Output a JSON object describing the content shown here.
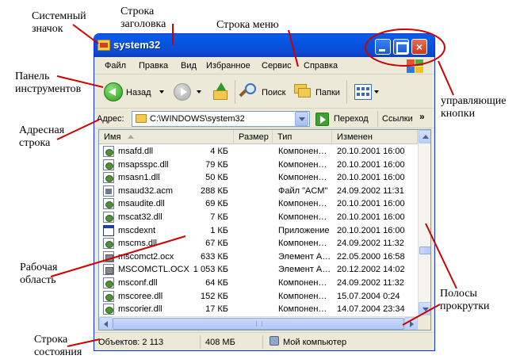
{
  "annotations": {
    "system_icon": "Системный\nзначок",
    "title_bar": "Строка\nзаголовка",
    "menu_bar": "Строка меню",
    "toolbar": "Панель\nинструментов",
    "address_bar": "Адресная\nстрока",
    "control_buttons": "управляющие\nкнопки",
    "work_area": "Рабочая\nобласть",
    "scrollbars": "Полосы\nпрокрутки",
    "status_bar": "Строка\nсостояния"
  },
  "window": {
    "title": "system32",
    "icon": "folder-icon"
  },
  "menu": [
    "Файл",
    "Правка",
    "Вид",
    "Избранное",
    "Сервис",
    "Справка"
  ],
  "toolbar": {
    "back_label": "Назад",
    "search_label": "Поиск",
    "folders_label": "Папки"
  },
  "address": {
    "label": "Адрес:",
    "value": "C:\\WINDOWS\\system32",
    "go_label": "Переход",
    "links_label": "Ссылки",
    "chevron": "»"
  },
  "columns": {
    "name": "Имя",
    "size": "Размер",
    "type": "Тип",
    "modified": "Изменен"
  },
  "files": [
    {
      "name": "msafd.dll",
      "size": "4 КБ",
      "type": "Компонен…",
      "modified": "20.10.2001 16:00",
      "icon": "dll"
    },
    {
      "name": "msapsspc.dll",
      "size": "79 КБ",
      "type": "Компонен…",
      "modified": "20.10.2001 16:00",
      "icon": "dll"
    },
    {
      "name": "msasn1.dll",
      "size": "50 КБ",
      "type": "Компонен…",
      "modified": "20.10.2001 16:00",
      "icon": "dll"
    },
    {
      "name": "msaud32.acm",
      "size": "288 КБ",
      "type": "Файл \"ACM\"",
      "modified": "24.09.2002 11:31",
      "icon": "acm"
    },
    {
      "name": "msaudite.dll",
      "size": "69 КБ",
      "type": "Компонен…",
      "modified": "20.10.2001 16:00",
      "icon": "dll"
    },
    {
      "name": "mscat32.dll",
      "size": "7 КБ",
      "type": "Компонен…",
      "modified": "20.10.2001 16:00",
      "icon": "dll"
    },
    {
      "name": "mscdexnt",
      "size": "1 КБ",
      "type": "Приложение",
      "modified": "20.10.2001 16:00",
      "icon": "exe"
    },
    {
      "name": "mscms.dll",
      "size": "67 КБ",
      "type": "Компонен…",
      "modified": "24.09.2002 11:32",
      "icon": "dll"
    },
    {
      "name": "mscomct2.ocx",
      "size": "633 КБ",
      "type": "Элемент А…",
      "modified": "22.05.2000 16:58",
      "icon": "ocx"
    },
    {
      "name": "MSCOMCTL.OCX",
      "size": "1 053 КБ",
      "type": "Элемент А…",
      "modified": "20.12.2002 14:02",
      "icon": "ocx"
    },
    {
      "name": "msconf.dll",
      "size": "64 КБ",
      "type": "Компонен…",
      "modified": "24.09.2002 11:32",
      "icon": "dll"
    },
    {
      "name": "mscoree.dll",
      "size": "152 КБ",
      "type": "Компонен…",
      "modified": "15.07.2004 0:24",
      "icon": "dll"
    },
    {
      "name": "mscorier.dll",
      "size": "17 КБ",
      "type": "Компонен…",
      "modified": "14.07.2004 23:34",
      "icon": "dll"
    }
  ],
  "status": {
    "objects": "Объектов: 2 113",
    "size": "408 МБ",
    "location": "Мой компьютер"
  },
  "colors": {
    "title_bar": "#0554e0",
    "close_button": "#c9381c",
    "annotation_callout": "#cc0000"
  }
}
